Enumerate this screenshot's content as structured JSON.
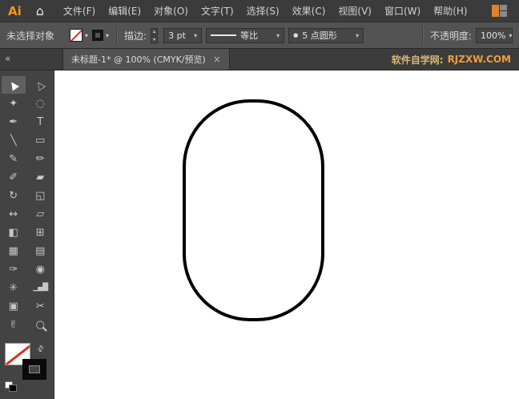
{
  "colors": {
    "accent_orange": "#F7931E",
    "watermark_orange": "#EF9E3A",
    "none_red": "#D93025",
    "stroke_black": "#000000",
    "ui_dark": "#3B3B3B",
    "ui_mid": "#535353"
  },
  "ui": {
    "dropdown_arrow": "▾",
    "up_arrow": "▴",
    "down_arrow": "▾",
    "collapse_icon": "«",
    "close_icon": "×",
    "home_icon": "⌂",
    "swap_icon": "⇄"
  },
  "menu_bar": {
    "logo": "Ai",
    "items": [
      "文件(F)",
      "编辑(E)",
      "对象(O)",
      "文字(T)",
      "选择(S)",
      "效果(C)",
      "视图(V)",
      "窗口(W)",
      "帮助(H)"
    ]
  },
  "control_bar": {
    "no_selection": "未选择对象",
    "fill": "none",
    "stroke_color": "#000000",
    "stroke_label": "描边:",
    "stroke_width": "3 pt",
    "profile_label": "等比",
    "brush_dot": "●",
    "brush_label": "5 点圆形",
    "opacity_label": "不透明度:",
    "opacity_value": "100%"
  },
  "tab_bar": {
    "title": "未标题-1* @ 100% (CMYK/预览)",
    "watermark_site": "软件自学网:",
    "watermark_url": "RJZXW.COM"
  },
  "toolbar": {
    "tools": [
      {
        "name": "selection",
        "glyph": "▲",
        "active": true
      },
      {
        "name": "direct-selection",
        "glyph": "△"
      },
      {
        "name": "magic-wand",
        "glyph": "✦"
      },
      {
        "name": "lasso",
        "glyph": "◌"
      },
      {
        "name": "pen",
        "glyph": "✒"
      },
      {
        "name": "type",
        "glyph": "T"
      },
      {
        "name": "line-segment",
        "glyph": "╲"
      },
      {
        "name": "rectangle",
        "glyph": "▭"
      },
      {
        "name": "paintbrush",
        "glyph": "✎"
      },
      {
        "name": "pencil",
        "glyph": "✏"
      },
      {
        "name": "blob-brush",
        "glyph": "✐"
      },
      {
        "name": "eraser",
        "glyph": "▰"
      },
      {
        "name": "rotate",
        "glyph": "↻"
      },
      {
        "name": "scale",
        "glyph": "◱"
      },
      {
        "name": "width",
        "glyph": "↔"
      },
      {
        "name": "free-transform",
        "glyph": "▱"
      },
      {
        "name": "shape-builder",
        "glyph": "◧"
      },
      {
        "name": "perspective-grid",
        "glyph": "⊞"
      },
      {
        "name": "mesh",
        "glyph": "▦"
      },
      {
        "name": "gradient",
        "glyph": "▤"
      },
      {
        "name": "eyedropper",
        "glyph": "✑"
      },
      {
        "name": "blend",
        "glyph": "◉"
      },
      {
        "name": "symbol-sprayer",
        "glyph": "✳"
      },
      {
        "name": "column-graph",
        "glyph": "▁▄█"
      },
      {
        "name": "artboard",
        "glyph": "▣"
      },
      {
        "name": "slice",
        "glyph": "✂"
      },
      {
        "name": "hand",
        "glyph": "✌"
      },
      {
        "name": "zoom",
        "glyph": "○"
      }
    ]
  },
  "swatch_panel": {
    "fill": "none",
    "stroke": "#000000"
  },
  "canvas": {
    "shape": {
      "type": "rounded-rectangle",
      "fill": "#FFFFFF",
      "stroke": "#000000",
      "stroke_width": "3 pt"
    }
  }
}
